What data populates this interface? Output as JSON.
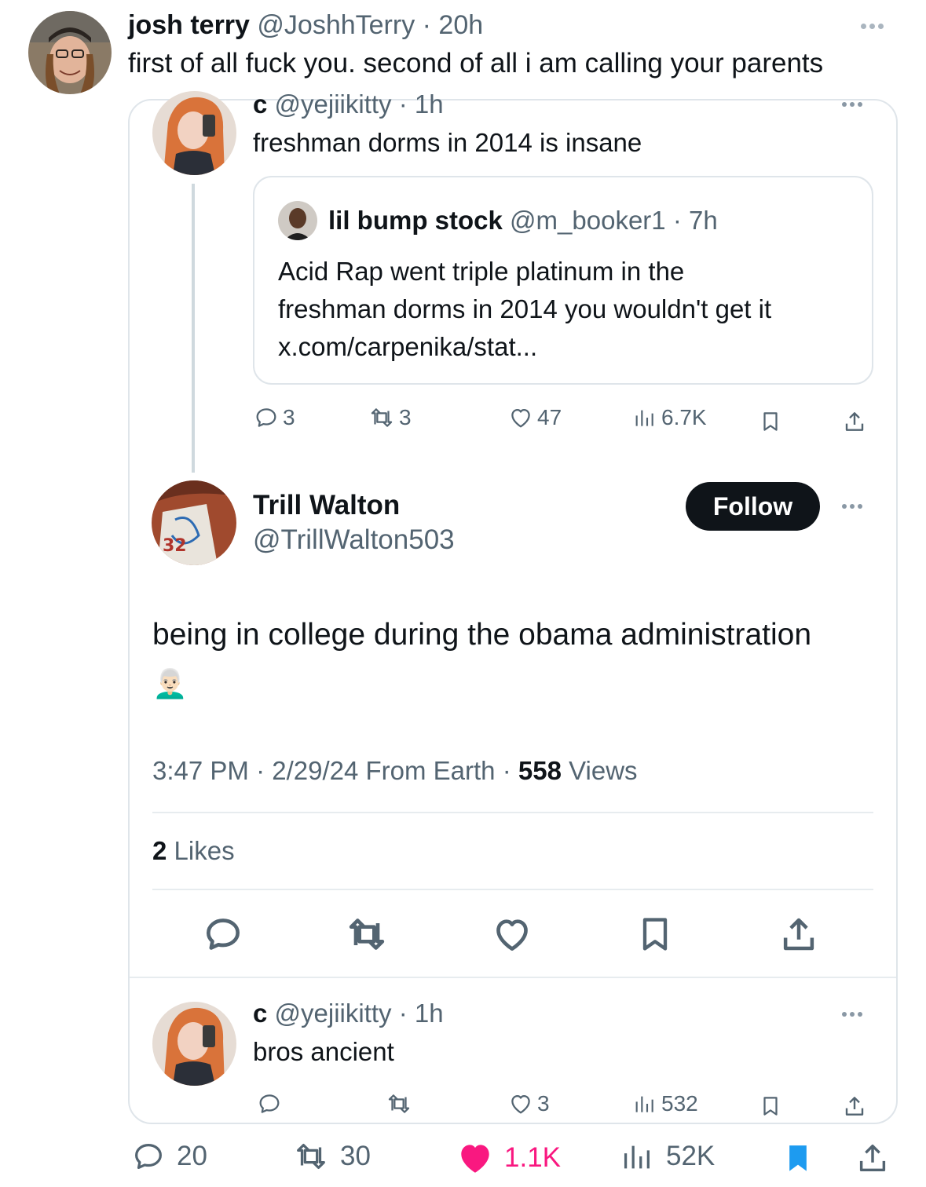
{
  "main_post": {
    "author_name": "josh terry",
    "author_handle": "@JoshhTerry",
    "time": "· 20h",
    "text": "first of all fuck you. second of all i am calling your parents",
    "stats": {
      "replies": "20",
      "reposts": "30",
      "likes": "1.1K",
      "views": "52K"
    },
    "liked": true,
    "bookmarked": true
  },
  "quoted_thread": {
    "parent_reply": {
      "author_name": "c",
      "author_handle": "@yejiikitty",
      "time": "· 1h",
      "text": "freshman dorms in 2014 is insane",
      "stats": {
        "replies": "3",
        "reposts": "3",
        "likes": "47",
        "views": "6.7K"
      }
    },
    "nested_quote": {
      "author_name": "lil bump stock",
      "author_handle": "@m_booker1",
      "time": "· 7h",
      "text_line1": "Acid Rap went triple platinum in the",
      "text_line2": "freshman dorms in 2014 you wouldn't get it",
      "link": "x.com/carpenika/stat..."
    },
    "focused_post": {
      "author_name": "Trill Walton",
      "author_handle": "@TrillWalton503",
      "follow_label": "Follow",
      "text": "being in college during the obama administration",
      "emoji": "👨🏻‍🦳",
      "timestamp": "3:47 PM · 2/29/24 From Earth · ",
      "views_count": "558",
      "views_label": " Views",
      "likes_count": "2",
      "likes_label": " Likes"
    },
    "child_reply": {
      "author_name": "c",
      "author_handle": "@yejiikitty",
      "time": "· 1h",
      "text": "bros ancient",
      "stats": {
        "replies": "",
        "reposts": "",
        "likes": "3",
        "views": "532"
      }
    }
  },
  "colors": {
    "text": "#0f1419",
    "muted": "#536471",
    "like": "#f91880",
    "bookmark": "#1d9bf0",
    "border": "#dfe5ea"
  },
  "icons": [
    "more-icon",
    "reply-icon",
    "repost-icon",
    "like-icon",
    "views-icon",
    "bookmark-icon",
    "share-icon"
  ]
}
